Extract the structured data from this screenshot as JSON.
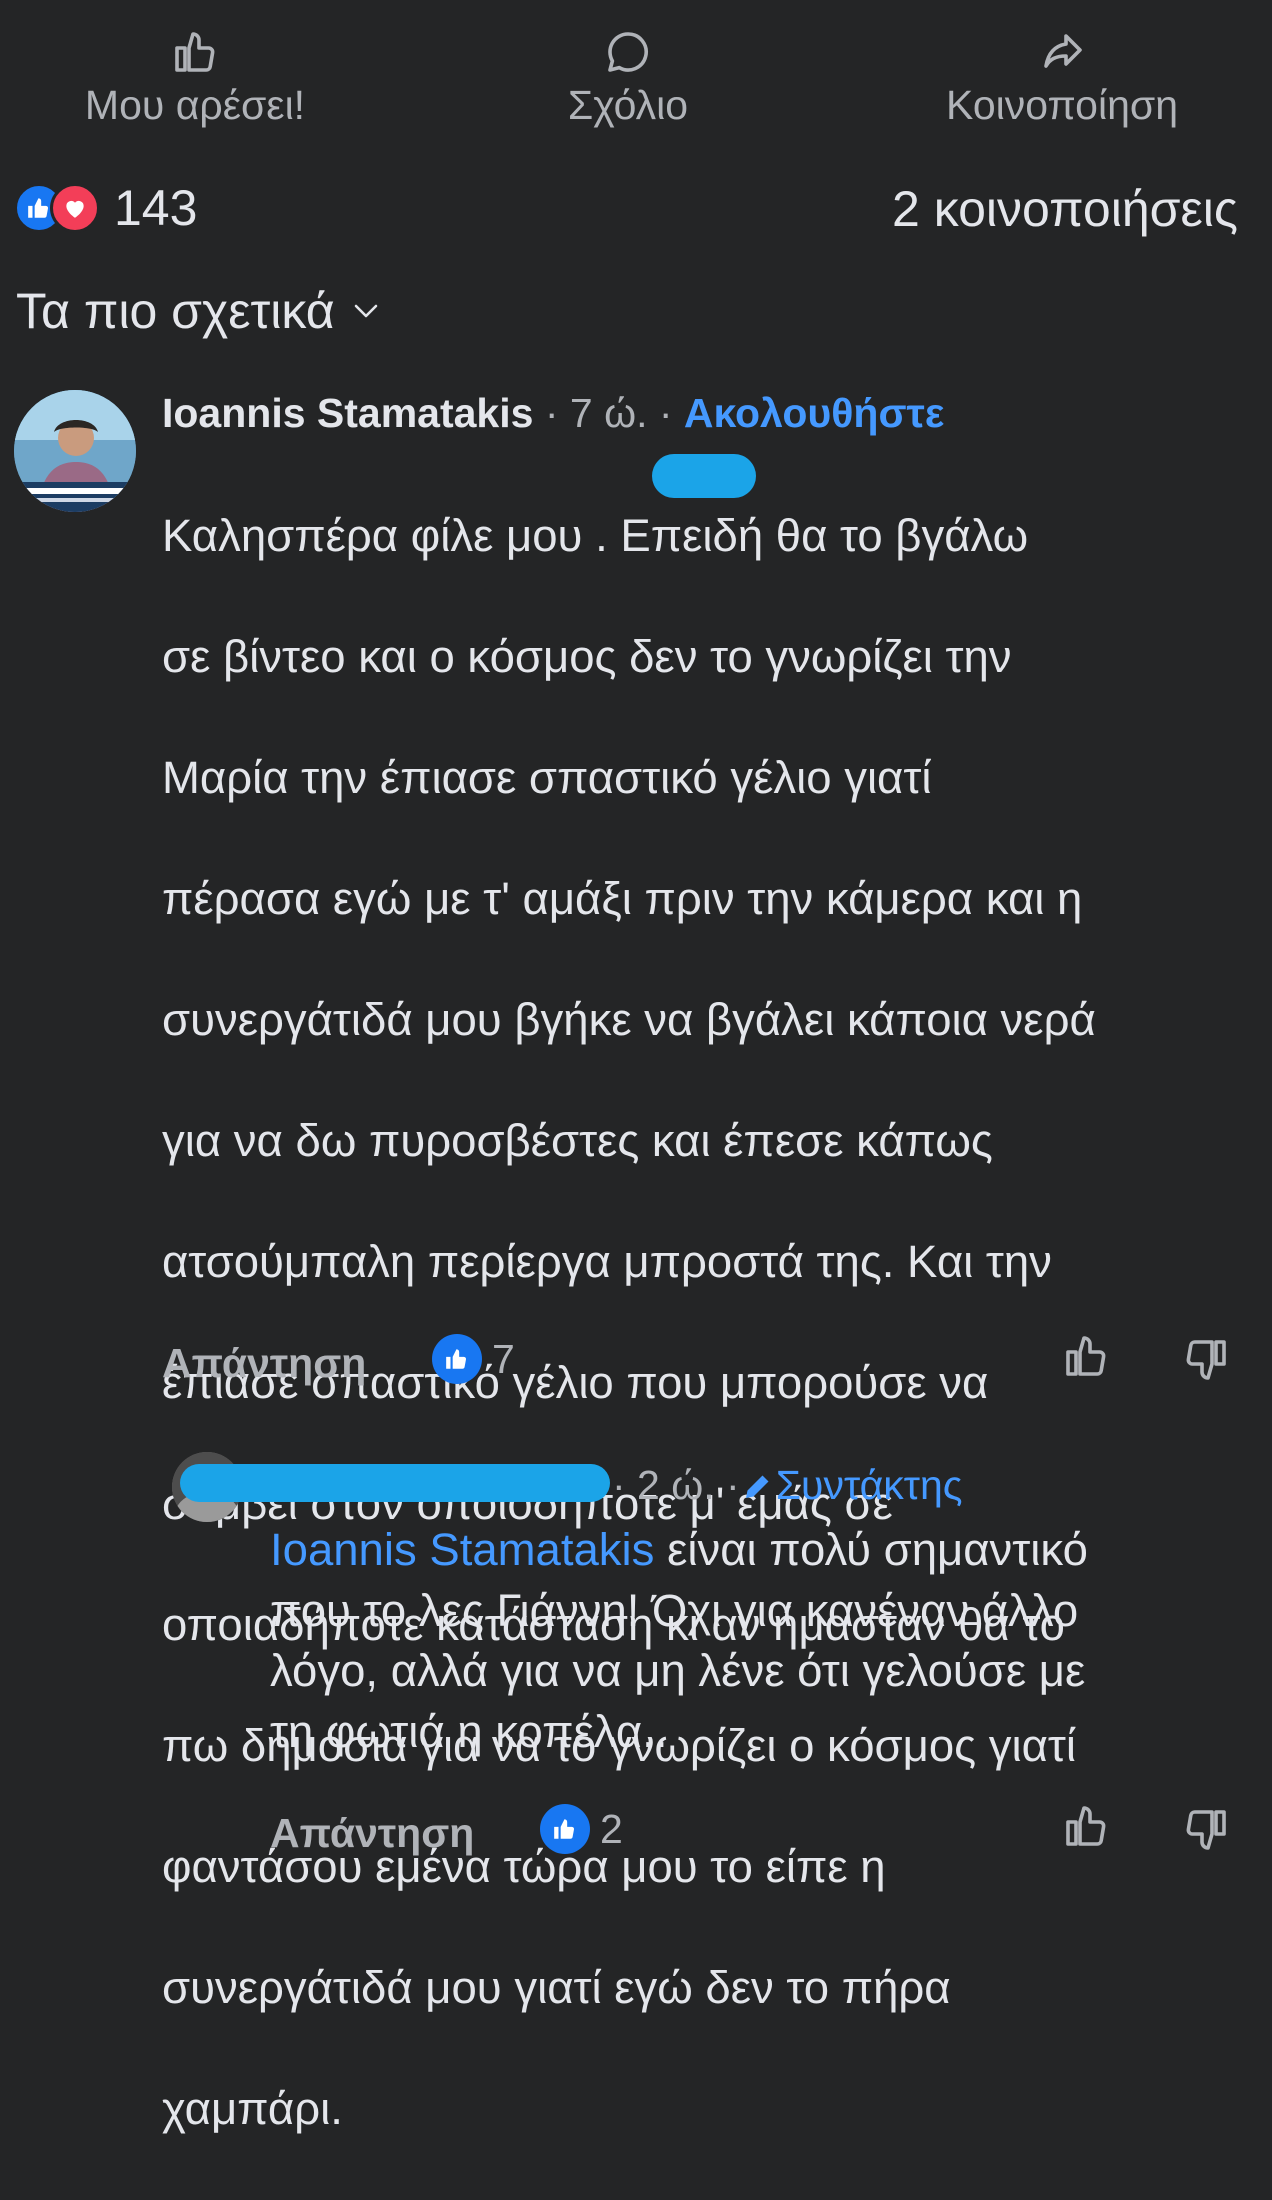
{
  "actions": {
    "like_label": "Μου αρέσει!",
    "comment_label": "Σχόλιο",
    "share_label": "Κοινοποίηση"
  },
  "summary": {
    "reaction_count": "143",
    "shares_text": "2 κοινοποιήσεις"
  },
  "sort": {
    "label": "Τα πιο σχετικά"
  },
  "comment": {
    "author": "Ioannis Stamatakis",
    "time": " · 7 ώ. · ",
    "follow_label": "Ακολουθήστε",
    "text_lines": [
      "Καλησπέρα φίλε μου      . Επειδή θα το βγάλω",
      "σε βίντεο και ο κόσμος δεν το γνωρίζει την",
      "Μαρία την έπιασε σπαστικό γέλιο γιατί",
      "πέρασα εγώ με τ' αμάξι πριν την κάμερα και η",
      "συνεργάτιδά μου βγήκε να βγάλει κάποια νερά",
      "για να δω πυροσβέστες και έπεσε κάπως",
      "ατσούμπαλη περίεργα μπροστά της. Και την",
      "έπιασε σπαστικό γέλιο που μπορούσε να",
      "συμβεί στον οποιοδήποτε μ' εμάς σε",
      "οποιαδήποτε κατάσταση κι αν ήμασταν θα το",
      "πω δημόσια για να το γνωρίζει ο κόσμος γιατί",
      "φαντάσου εμένα τώρα μου το είπε η",
      "συνεργάτιδά μου γιατί εγώ δεν το πήρα",
      "χαμπάρι."
    ],
    "reply_label": "Απάντηση",
    "like_count": "7"
  },
  "reply": {
    "time": " · 2 ώ. · ",
    "editor_label": "Συντάκτης",
    "mention": "Ioannis Stamatakis",
    "text_first": " είναι πολύ σημαντικό",
    "text_lines": [
      "που το λες Γιάννη! Όχι για κανέναν άλλο",
      "λόγο, αλλά για να μη λένε ότι γελούσε με",
      "τη φωτιά η κοπέλα.."
    ],
    "reply_label": "Απάντηση",
    "like_count": "2"
  },
  "colors": {
    "background": "#242526",
    "text": "#e4e6eb",
    "muted": "#b0b3b8",
    "link": "#4599ff",
    "like_blue": "#1877f2",
    "love_red": "#f33e58",
    "redaction": "#1ba4e8"
  },
  "icons": [
    "thumbs-up-icon",
    "comment-bubble-icon",
    "share-arrow-icon",
    "like-reaction-icon",
    "love-reaction-icon",
    "chevron-down-icon",
    "thumbs-down-icon",
    "pencil-icon"
  ]
}
